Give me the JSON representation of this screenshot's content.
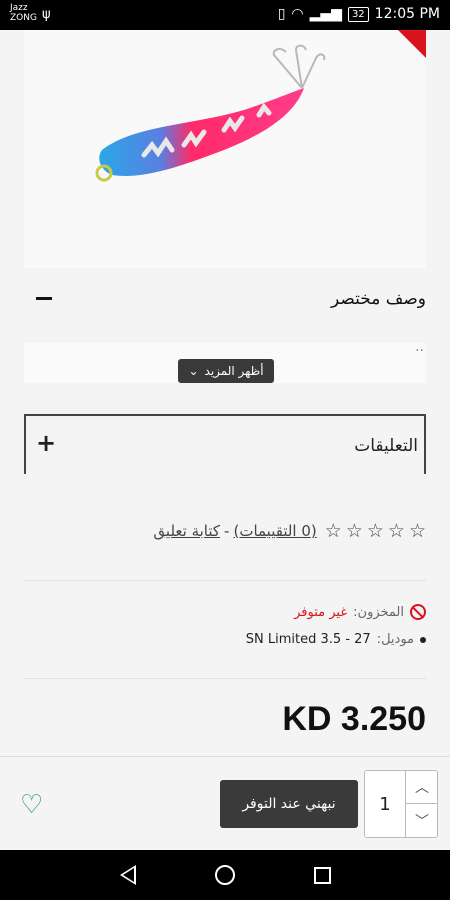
{
  "status_bar": {
    "carrier_line1": "Jazz",
    "carrier_line2": "ZONG",
    "battery": "32",
    "time": "12:05 PM"
  },
  "description": {
    "title": "وصف مختصر",
    "body": "..",
    "show_more": "أظهر المزيد"
  },
  "reviews": {
    "title": "التعليقات"
  },
  "rating": {
    "count_label": "(0 التقييمات)",
    "separator": "-",
    "write_review": "كتابة تعليق"
  },
  "stock": {
    "label": "المخزون:",
    "value": "غير متوفر"
  },
  "model": {
    "label": "موديل:",
    "value": "SN Limited 3.5 - 27"
  },
  "price": "KD 3.250",
  "cart": {
    "notify_label": "نبهني عند التوفر",
    "quantity": "1"
  },
  "colors": {
    "accent_red": "#d8141c",
    "wishlist_green": "#2a9d5a",
    "button_dark": "#3a3a3a"
  }
}
